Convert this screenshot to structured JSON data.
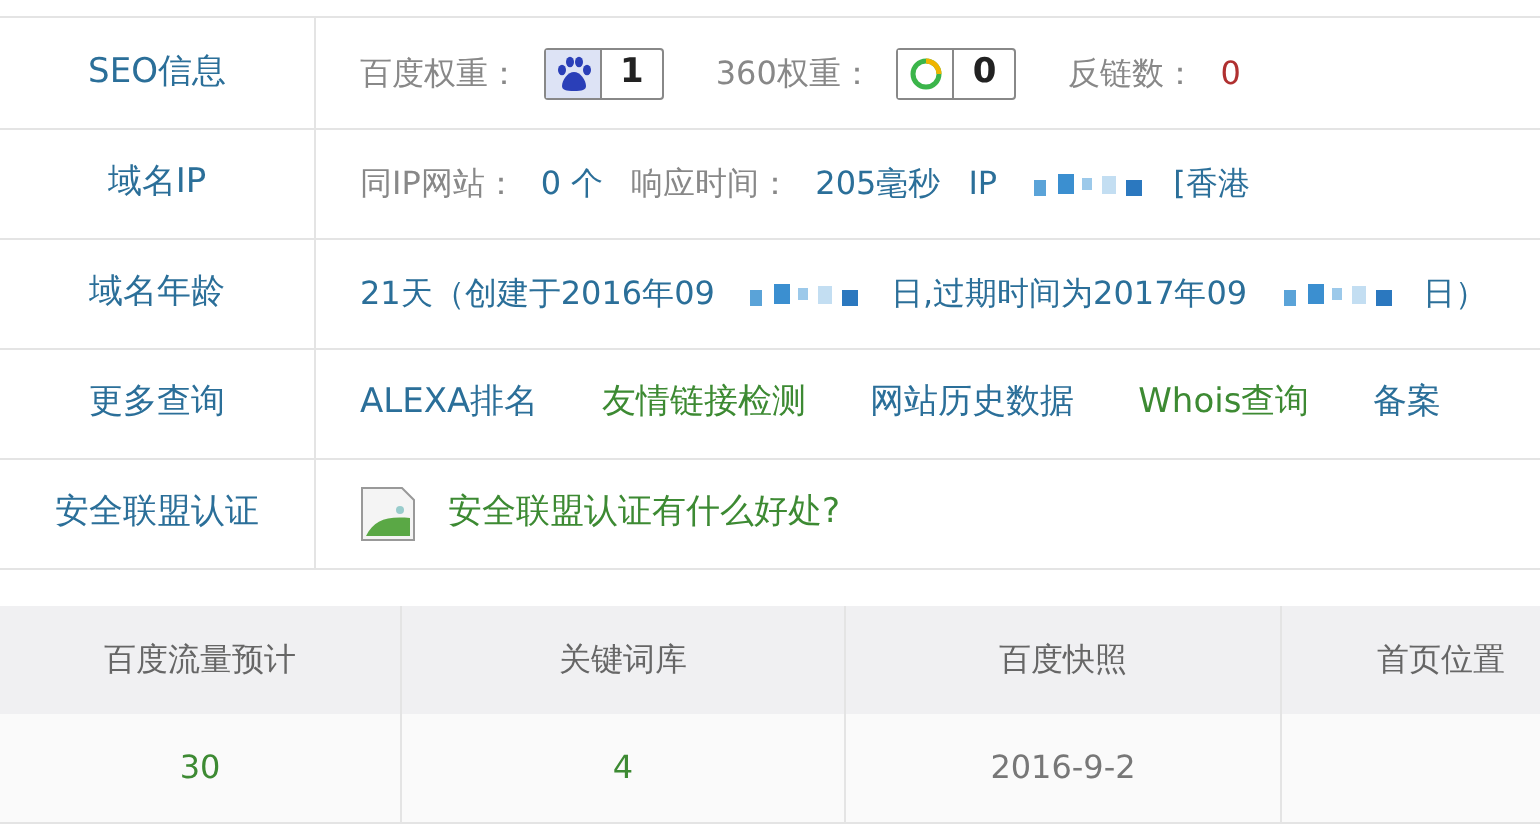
{
  "info_table": {
    "rows": [
      {
        "label": "SEO信息",
        "items": [
          {
            "kind": "caption",
            "text": "百度权重："
          },
          {
            "kind": "pawbadge",
            "text": "1"
          },
          {
            "kind": "caption",
            "text": "360权重："
          },
          {
            "kind": "ringbadge",
            "text": "0"
          },
          {
            "kind": "caption",
            "text": "反链数："
          },
          {
            "kind": "text",
            "text": "0",
            "color": "#b03030"
          }
        ]
      },
      {
        "label": "域名IP",
        "items": [
          {
            "kind": "caption",
            "text": "同IP网站："
          },
          {
            "kind": "text",
            "text": "0 个",
            "color": "#2b6f99"
          },
          {
            "kind": "caption",
            "text": "响应时间："
          },
          {
            "kind": "text",
            "text": "205毫秒",
            "color": "#2b6f99"
          },
          {
            "kind": "text",
            "text": "IP",
            "color": "#2b6f99"
          },
          {
            "kind": "redaction"
          },
          {
            "kind": "text",
            "text": "[香港",
            "color": "#2b6f99"
          }
        ]
      },
      {
        "label": "域名年龄",
        "items": [
          {
            "kind": "text",
            "text": "21天（创建于2016年09",
            "color": "#2b6f99"
          },
          {
            "kind": "redaction"
          },
          {
            "kind": "text",
            "text": "日,过期时间为2017年09",
            "color": "#2b6f99"
          },
          {
            "kind": "redaction"
          },
          {
            "kind": "text",
            "text": "日）",
            "color": "#2b6f99"
          }
        ]
      },
      {
        "label": "更多查询",
        "items": [
          {
            "kind": "link",
            "text": "ALEXA排名",
            "color": "#2b6f99"
          },
          {
            "kind": "link",
            "text": "友情链接检测",
            "color": "#3d8a33"
          },
          {
            "kind": "link",
            "text": "网站历史数据",
            "color": "#2b6f99"
          },
          {
            "kind": "link",
            "text": "Whois查询",
            "color": "#3d8a33"
          },
          {
            "kind": "link",
            "text": "备案",
            "color": "#2b6f99"
          }
        ]
      },
      {
        "label": "安全联盟认证",
        "items": [
          {
            "kind": "image"
          },
          {
            "kind": "link",
            "text": "安全联盟认证有什么好处?",
            "color": "#3d8a33"
          }
        ]
      }
    ]
  },
  "stats_table": {
    "columns": [
      "百度流量预计",
      "关键词库",
      "百度快照",
      "首页位置"
    ],
    "row": [
      {
        "text": "30",
        "color": "#3d8a33"
      },
      {
        "text": "4",
        "color": "#3d8a33"
      },
      {
        "text": "2016-9-2",
        "color": "#777777"
      }
    ]
  }
}
